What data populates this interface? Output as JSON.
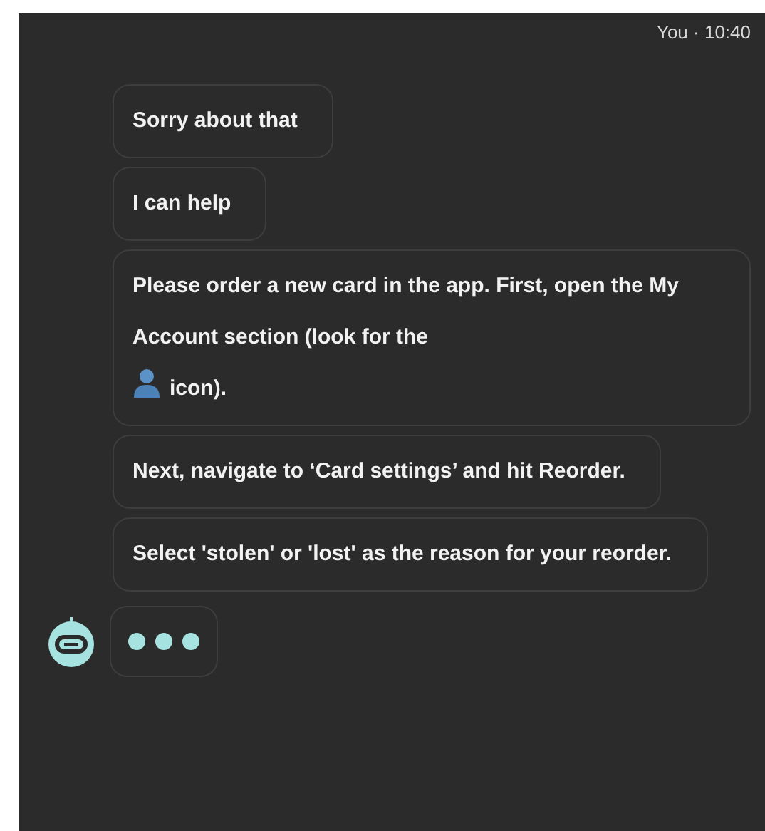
{
  "header": {
    "sender": "You",
    "time": "10:40",
    "separator": "·"
  },
  "messages": [
    {
      "kind": "text",
      "segments": [
        {
          "kind": "text",
          "text": "Sorry about that"
        }
      ]
    },
    {
      "kind": "text",
      "segments": [
        {
          "kind": "text",
          "text": "I can help"
        }
      ]
    },
    {
      "kind": "text",
      "segments": [
        {
          "kind": "text",
          "text": "Please order a new card in the app. First, open the My Account section (look for the"
        },
        {
          "kind": "icon"
        },
        {
          "kind": "text",
          "text": "icon)."
        }
      ]
    },
    {
      "kind": "text",
      "segments": [
        {
          "kind": "text",
          "text": "Next, navigate to ‘Card settings’ and hit Reorder."
        }
      ]
    },
    {
      "kind": "text",
      "segments": [
        {
          "kind": "text",
          "text": "Select 'stolen' or 'lost' as the reason for your reorder."
        }
      ]
    },
    {
      "kind": "typing"
    }
  ]
}
